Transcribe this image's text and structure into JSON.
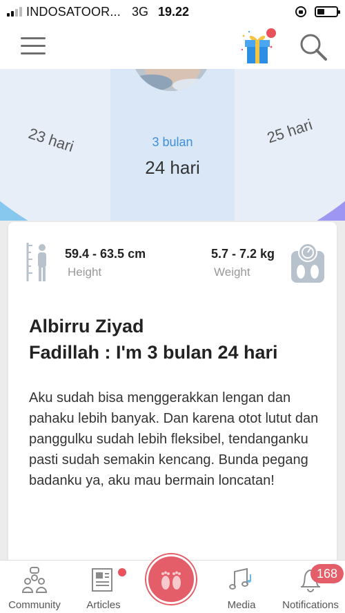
{
  "status_bar": {
    "carrier": "INDOSATOOR...",
    "network": "3G",
    "time": "19.22"
  },
  "header": {
    "menu_icon": "hamburger-menu-icon",
    "gift_icon": "gift-icon",
    "search_icon": "search-icon"
  },
  "hero": {
    "prev_day": "23 hari",
    "current_month": "3 bulan",
    "current_day": "24 hari",
    "next_day": "25 hari"
  },
  "card": {
    "height_value": "59.4  - 63.5 cm",
    "height_label": "Height",
    "weight_value": "5.7 - 7.2 kg",
    "weight_label": "Weight",
    "title_line1": "Albirru Ziyad",
    "title_line2": "Fadillah : I'm 3 bulan 24 hari",
    "description": "Aku sudah bisa menggerakkan lengan dan pahaku lebih banyak. Dan karena otot lutut dan panggulku sudah lebih fleksibel, tendanganku pasti sudah semakin kencang. Bunda pegang badanku ya, aku mau bermain loncatan!"
  },
  "bottom_nav": {
    "items": [
      {
        "label": "Community",
        "icon": "community-icon"
      },
      {
        "label": "Articles",
        "icon": "articles-icon"
      },
      {
        "label": "Media",
        "icon": "media-icon"
      },
      {
        "label": "Notifications",
        "icon": "bell-icon"
      }
    ],
    "center_icon": "footprints-icon",
    "notification_count": "168"
  },
  "colors": {
    "accent_red": "#e45e69",
    "accent_blue": "#3f8fd8"
  }
}
